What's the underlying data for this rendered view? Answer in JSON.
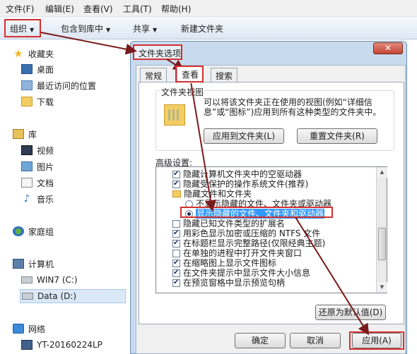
{
  "menubar": {
    "items": [
      {
        "label": "文件(F)"
      },
      {
        "label": "编辑(E)"
      },
      {
        "label": "查看(V)"
      },
      {
        "label": "工具(T)"
      },
      {
        "label": "帮助(H)"
      }
    ]
  },
  "toolbar": {
    "organize": "组织",
    "include_in_library": "包含到库中",
    "share": "共享",
    "new_folder": "新建文件夹"
  },
  "nav": {
    "favorites": "收藏夹",
    "desktop": "桌面",
    "recent": "最近访问的位置",
    "downloads": "下载",
    "libraries": "库",
    "videos": "视频",
    "pictures": "图片",
    "documents": "文档",
    "music": "音乐",
    "homegroup": "家庭组",
    "computer": "计算机",
    "drive_c": "WIN7 (C:)",
    "drive_d": "Data (D:)",
    "network": "网络",
    "host": "YT-20160224LP"
  },
  "dialog": {
    "title": "文件夹选项",
    "tabs": [
      "常规",
      "查看",
      "搜索"
    ],
    "folder_views": {
      "label": "文件夹视图",
      "text": "可以将该文件夹正在使用的视图(例如“详细信息”或“图标”)应用到所有这种类型的文件夹中。",
      "apply_button": "应用到文件夹(L)",
      "reset_button": "重置文件夹(R)"
    },
    "advanced": {
      "label": "高级设置:",
      "items": [
        {
          "text": "隐藏计算机文件夹中的空驱动器",
          "kind": "checkbox",
          "checked": true
        },
        {
          "text": "隐藏受保护的操作系统文件(推荐)",
          "kind": "checkbox",
          "checked": true
        },
        {
          "text": "隐藏文件和文件夹",
          "kind": "folder"
        },
        {
          "text": "不显示隐藏的文件、文件夹或驱动器",
          "kind": "radio",
          "checked": false
        },
        {
          "text": "显示隐藏的文件、文件夹和驱动器",
          "kind": "radio",
          "checked": true,
          "selected": true
        },
        {
          "text": "隐藏已知文件类型的扩展名",
          "kind": "checkbox",
          "checked": false
        },
        {
          "text": "用彩色显示加密或压缩的 NTFS 文件",
          "kind": "checkbox",
          "checked": true
        },
        {
          "text": "在标题栏显示完整路径(仅限经典主题)",
          "kind": "checkbox",
          "checked": true
        },
        {
          "text": "在单独的进程中打开文件夹窗口",
          "kind": "checkbox",
          "checked": false
        },
        {
          "text": "在缩略图上显示文件图标",
          "kind": "checkbox",
          "checked": true
        },
        {
          "text": "在文件夹提示中显示文件大小信息",
          "kind": "checkbox",
          "checked": true
        },
        {
          "text": "在预览窗格中显示预览句柄",
          "kind": "checkbox",
          "checked": true
        }
      ]
    },
    "restore_defaults": "还原为默认值(D)",
    "ok": "确定",
    "cancel": "取消",
    "apply": "应用(A)"
  },
  "colors": {
    "annotation": "#d23030",
    "arrow": "#7a1a1a",
    "selection": "#3399ff"
  }
}
